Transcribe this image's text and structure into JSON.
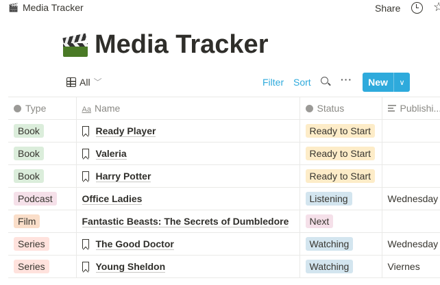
{
  "topbar": {
    "breadcrumb": "Media Tracker",
    "share": "Share"
  },
  "page": {
    "title": "Media Tracker"
  },
  "toolbar": {
    "view": "All",
    "filter": "Filter",
    "sort": "Sort",
    "new": "New"
  },
  "columns": {
    "type": "Type",
    "name": "Name",
    "status": "Status",
    "publishing": "Publishi..."
  },
  "colors": {
    "Book": "#dbeddb",
    "Podcast": "#f5e0e9",
    "Film": "#fadec9",
    "Series": "#ffe2dd",
    "Ready to Start": "#fdecc8",
    "Listening": "#d3e5ef",
    "Watching": "#d3e5ef",
    "Next": "#f5e0e9",
    "accent": "#2eaadc"
  },
  "rows": [
    {
      "type": "Book",
      "name": "Ready Player",
      "bookmark": true,
      "status": "Ready to Start",
      "publishing": ""
    },
    {
      "type": "Book",
      "name": "Valeria",
      "bookmark": true,
      "status": "Ready to Start",
      "publishing": ""
    },
    {
      "type": "Book",
      "name": "Harry Potter",
      "bookmark": true,
      "status": "Ready to Start",
      "publishing": ""
    },
    {
      "type": "Podcast",
      "name": "Office Ladies",
      "bookmark": false,
      "status": "Listening",
      "publishing": "Wednesday"
    },
    {
      "type": "Film",
      "name": "Fantastic Beasts: The Secrets of Dumbledore",
      "bookmark": false,
      "status": "Next",
      "publishing": ""
    },
    {
      "type": "Series",
      "name": "The Good Doctor",
      "bookmark": true,
      "status": "Watching",
      "publishing": "Wednesday"
    },
    {
      "type": "Series",
      "name": "Young Sheldon",
      "bookmark": true,
      "status": "Watching",
      "publishing": "Viernes"
    }
  ]
}
